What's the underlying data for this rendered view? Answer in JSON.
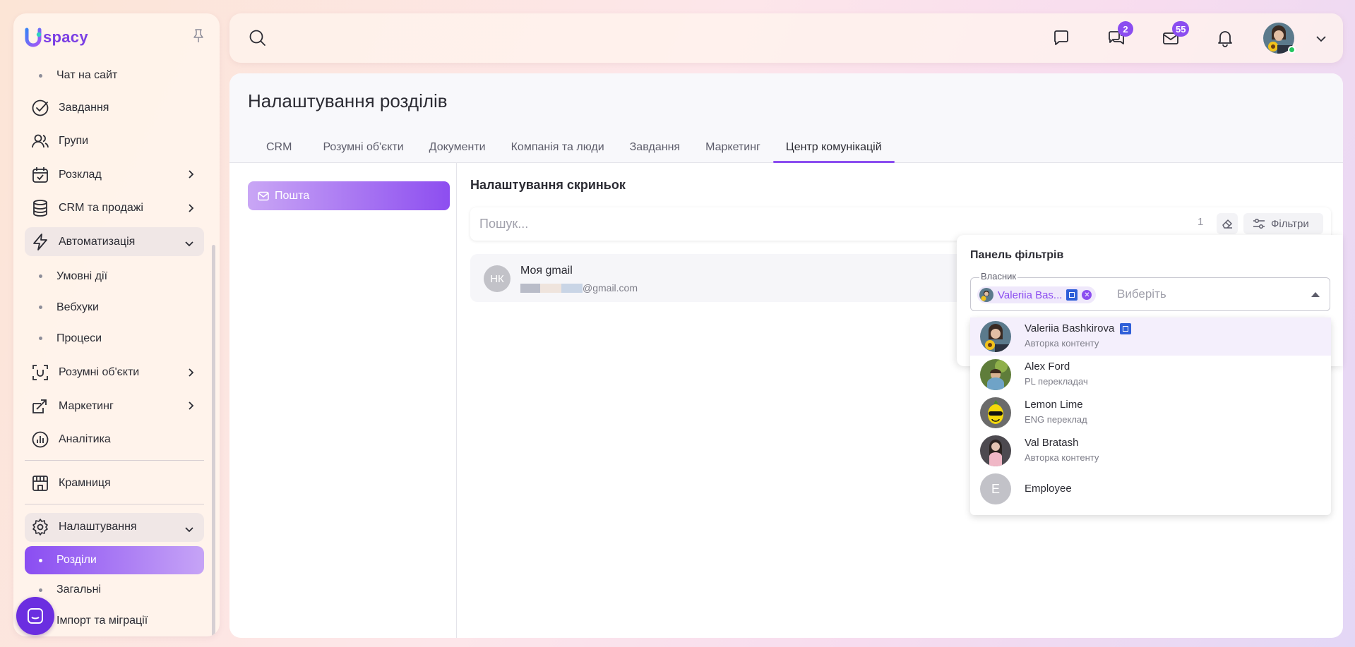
{
  "brand": {
    "logo_text": "spacy",
    "accent": "#8b4df0"
  },
  "sidebar": {
    "items": [
      {
        "type": "sub",
        "label": "Чат на сайт"
      },
      {
        "type": "item",
        "label": "Завдання",
        "icon": "check-circle-icon"
      },
      {
        "type": "item",
        "label": "Групи",
        "icon": "users-icon"
      },
      {
        "type": "item",
        "label": "Розклад",
        "icon": "calendar-icon",
        "chevron": "right"
      },
      {
        "type": "item",
        "label": "CRM та продажі",
        "icon": "database-icon",
        "chevron": "right"
      },
      {
        "type": "item",
        "label": "Автоматизація",
        "icon": "lightning-icon",
        "chevron": "down"
      },
      {
        "type": "sub",
        "label": "Умовні дії"
      },
      {
        "type": "sub",
        "label": "Вебхуки"
      },
      {
        "type": "sub",
        "label": "Процеси"
      },
      {
        "type": "item",
        "label": "Розумні об'єкти",
        "icon": "scan-icon",
        "chevron": "right"
      },
      {
        "type": "item",
        "label": "Маркетинг",
        "icon": "marketing-icon",
        "chevron": "right"
      },
      {
        "type": "item",
        "label": "Аналітика",
        "icon": "chart-icon"
      },
      {
        "type": "item",
        "label": "Крамниця",
        "icon": "store-icon"
      },
      {
        "type": "item",
        "label": "Налаштування",
        "icon": "gear-icon",
        "chevron": "down"
      },
      {
        "type": "sub",
        "label": "Розділи",
        "active": true
      },
      {
        "type": "sub",
        "label": "Загальні"
      },
      {
        "type": "sub",
        "label": "Імпорт та міграції"
      }
    ]
  },
  "topbar": {
    "chat_badge": "2",
    "mail_badge": "55"
  },
  "page": {
    "title": "Налаштування розділів",
    "tabs": [
      {
        "label": "CRM"
      },
      {
        "label": "Розумні об'єкти"
      },
      {
        "label": "Документи"
      },
      {
        "label": "Компанія та люди"
      },
      {
        "label": "Завдання"
      },
      {
        "label": "Маркетинг"
      },
      {
        "label": "Центр комунікацій",
        "active": true
      }
    ],
    "left_menu_label": "Пошта"
  },
  "mailboxes": {
    "title": "Налаштування скриньок",
    "search_placeholder": "Пошук...",
    "filter_count": "1",
    "filters_label": "Фільтри",
    "card": {
      "initials": "НК",
      "name": "Моя gmail",
      "email_suffix": "@gmail.com"
    }
  },
  "filter_panel": {
    "title": "Панель фільтрів",
    "owner_label": "Власник",
    "chip_text": "Valeriia Bas...",
    "select_placeholder": "Виберіть",
    "options": [
      {
        "name": "Valeriia Bashkirova",
        "role": "Авторка контенту",
        "badge": true,
        "selected": true
      },
      {
        "name": "Alex Ford",
        "role": "PL перекладач"
      },
      {
        "name": "Lemon Lime",
        "role": "ENG переклад"
      },
      {
        "name": "Val Bratash",
        "role": "Авторка контенту"
      },
      {
        "name": "Employee",
        "role": "",
        "initial": "E"
      }
    ]
  }
}
